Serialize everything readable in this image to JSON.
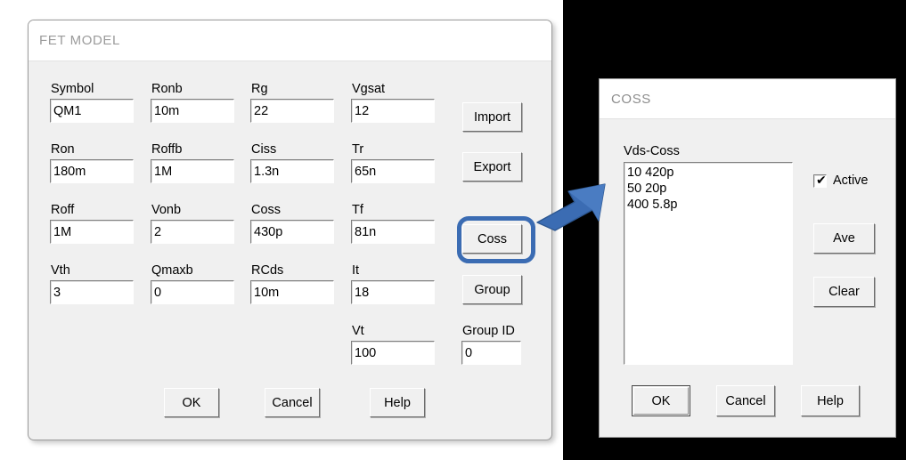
{
  "fet_dialog": {
    "title": "FET MODEL",
    "fields": [
      {
        "label": "Symbol",
        "value": "QM1"
      },
      {
        "label": "Ronb",
        "value": "10m"
      },
      {
        "label": "Rg",
        "value": "22"
      },
      {
        "label": "Vgsat",
        "value": "12"
      },
      {
        "label": "Ron",
        "value": "180m"
      },
      {
        "label": "Roffb",
        "value": "1M"
      },
      {
        "label": "Ciss",
        "value": "1.3n"
      },
      {
        "label": "Tr",
        "value": "65n"
      },
      {
        "label": "Roff",
        "value": "1M"
      },
      {
        "label": "Vonb",
        "value": "2"
      },
      {
        "label": "Coss",
        "value": "430p"
      },
      {
        "label": "Tf",
        "value": "81n"
      },
      {
        "label": "Vth",
        "value": "3"
      },
      {
        "label": "Qmaxb",
        "value": "0"
      },
      {
        "label": "RCds",
        "value": "10m"
      },
      {
        "label": "It",
        "value": "18"
      },
      {
        "label": "Vt",
        "value": "100"
      },
      {
        "label": "Group ID",
        "value": "0"
      }
    ],
    "side_buttons": [
      {
        "label": "Import"
      },
      {
        "label": "Export"
      },
      {
        "label": "Coss"
      },
      {
        "label": "Group"
      }
    ],
    "bottom_buttons": [
      {
        "label": "OK"
      },
      {
        "label": "Cancel"
      },
      {
        "label": "Help"
      }
    ]
  },
  "coss_dialog": {
    "title": "COSS",
    "list_label": "Vds-Coss",
    "list_items": [
      "10 420p",
      "50 20p",
      "400 5.8p"
    ],
    "checkbox": {
      "label": "Active",
      "checked": true,
      "glyph": "✔"
    },
    "side_buttons": [
      {
        "label": "Ave"
      },
      {
        "label": "Clear"
      }
    ],
    "bottom_buttons": [
      {
        "label": "OK"
      },
      {
        "label": "Cancel"
      },
      {
        "label": "Help"
      }
    ]
  },
  "annotation": {
    "highlight_color": "#3b6cb3",
    "arrow_color": "#3b6cb3",
    "highlight_target": "Coss"
  }
}
